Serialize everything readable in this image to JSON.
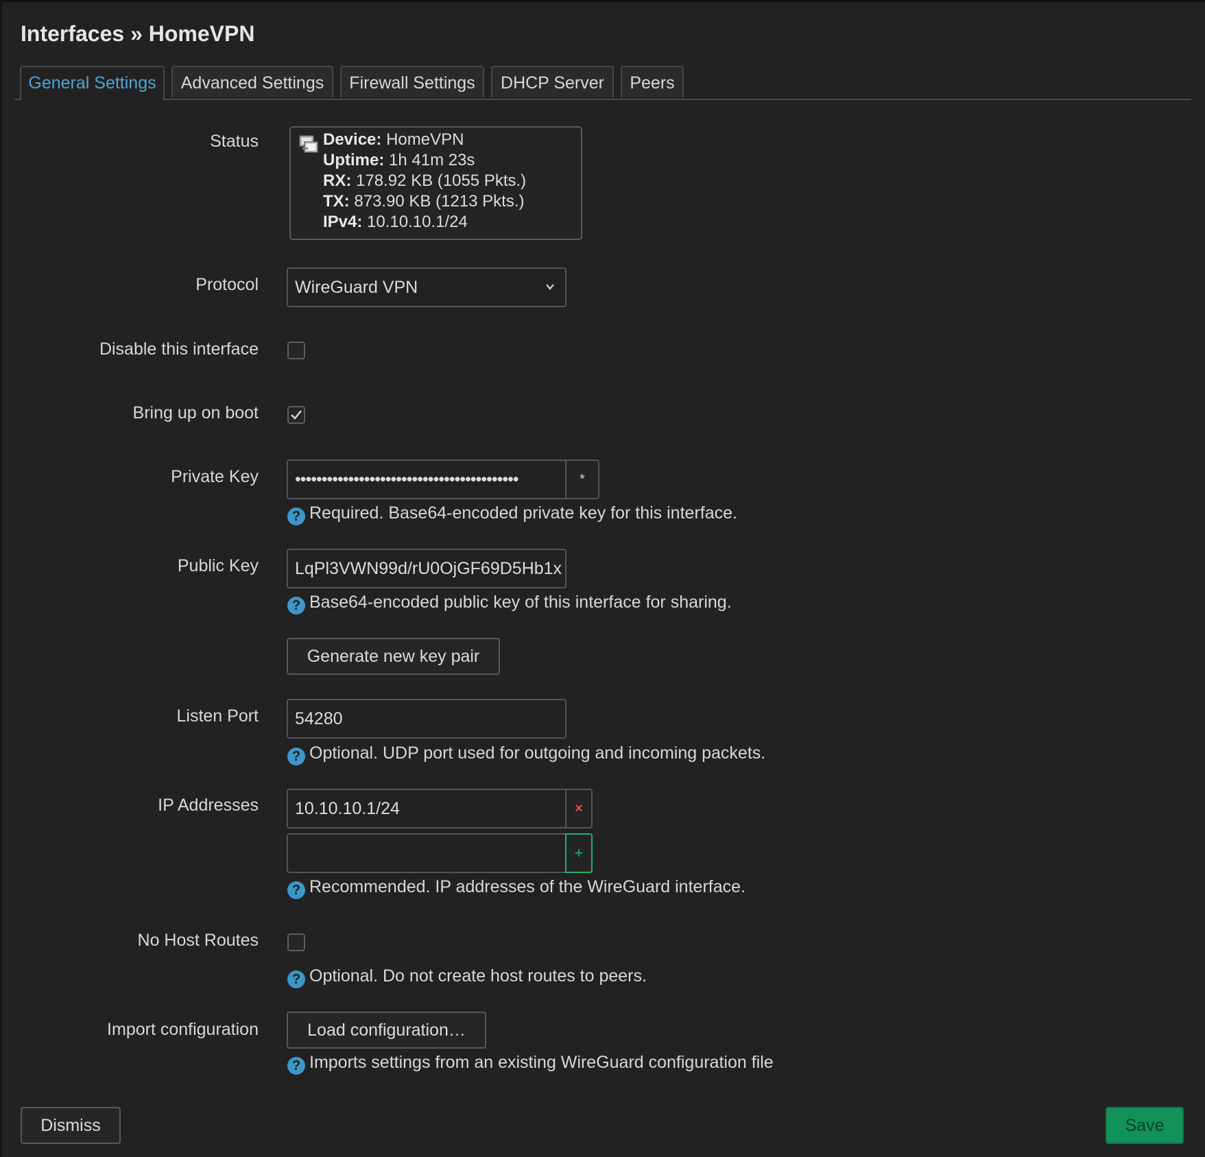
{
  "breadcrumb": {
    "section": "Interfaces",
    "separator": "»",
    "current": "HomeVPN"
  },
  "tabs": [
    {
      "label": "General Settings",
      "active": true
    },
    {
      "label": "Advanced Settings",
      "active": false
    },
    {
      "label": "Firewall Settings",
      "active": false
    },
    {
      "label": "DHCP Server",
      "active": false
    },
    {
      "label": "Peers",
      "active": false
    }
  ],
  "status": {
    "label": "Status",
    "device_key": "Device:",
    "device_value": "HomeVPN",
    "uptime_key": "Uptime:",
    "uptime_value": "1h 41m 23s",
    "rx_key": "RX:",
    "rx_value": "178.92 KB (1055 Pkts.)",
    "tx_key": "TX:",
    "tx_value": "873.90 KB (1213 Pkts.)",
    "ipv4_key": "IPv4:",
    "ipv4_value": "10.10.10.1/24"
  },
  "protocol": {
    "label": "Protocol",
    "selected": "WireGuard VPN"
  },
  "disable_interface": {
    "label": "Disable this interface",
    "checked": false
  },
  "bring_up_on_boot": {
    "label": "Bring up on boot",
    "checked": true
  },
  "private_key": {
    "label": "Private Key",
    "value": "••••••••••••••••••••••••••••••••••••••••••",
    "reveal_glyph": "*",
    "hint": "Required. Base64-encoded private key for this interface."
  },
  "public_key": {
    "label": "Public Key",
    "value": "LqPl3VWN99d/rU0OjGF69D5Hb1x",
    "hint": "Base64-encoded public key of this interface for sharing."
  },
  "generate_button": "Generate new key pair",
  "listen_port": {
    "label": "Listen Port",
    "value": "54280",
    "hint": "Optional. UDP port used for outgoing and incoming packets."
  },
  "ip_addresses": {
    "label": "IP Addresses",
    "values": [
      "10.10.10.1/24"
    ],
    "new_value": "",
    "remove_glyph": "×",
    "add_glyph": "+",
    "hint": "Recommended. IP addresses of the WireGuard interface."
  },
  "no_host_routes": {
    "label": "No Host Routes",
    "checked": false,
    "hint": "Optional. Do not create host routes to peers."
  },
  "import_config": {
    "label": "Import configuration",
    "button": "Load configuration…",
    "hint": "Imports settings from an existing WireGuard configuration file"
  },
  "hint_glyph": "?",
  "footer": {
    "dismiss": "Dismiss",
    "save": "Save"
  },
  "colors": {
    "background": "#222222",
    "accent_tab": "#4fa3d4",
    "hint_icon": "#3c97c9",
    "save_button": "#10925a",
    "remove_red": "#d9534f",
    "add_green": "#23b26d"
  },
  "icons": {
    "status": "network-device-icon",
    "select": "chevron-down-icon",
    "check": "checkmark-icon",
    "help": "help-icon"
  }
}
